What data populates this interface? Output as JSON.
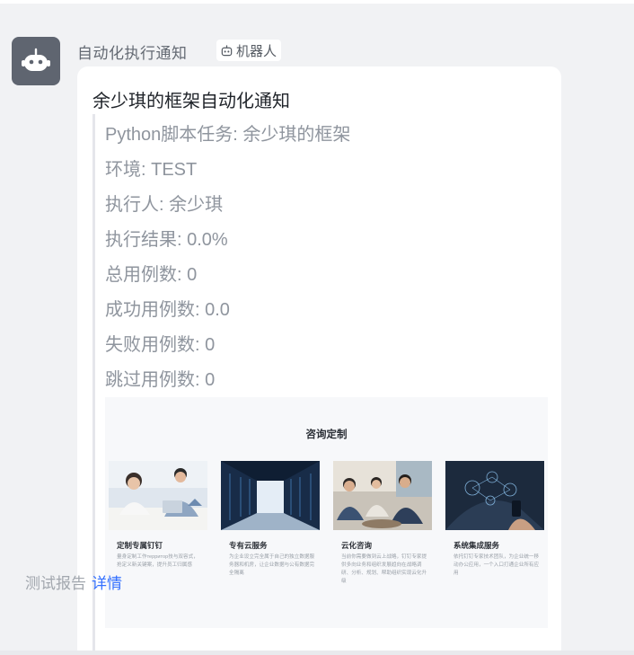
{
  "message": {
    "sender_name": "自动化执行通知",
    "bot_tag": "机器人",
    "avatar_icon": "robot-icon"
  },
  "card": {
    "title": "余少琪的框架自动化通知",
    "fields": [
      "Python脚本任务: 余少琪的框架",
      "环境: TEST",
      "执行人: 余少琪",
      "执行结果: 0.0%",
      "总用例数: 0",
      "成功用例数: 0.0",
      "失败用例数: 0",
      "跳过用例数: 0"
    ],
    "promo": {
      "title": "咨询定制",
      "services": [
        {
          "title": "定制专属钉钉",
          "desc": "量身定制工作территор技与双容式，抢定义新关键案，提升员工归属感"
        },
        {
          "title": "专有云服务",
          "desc": "为企业设立完全属于自己的独立数据服务器和机房，让企业数据与公有数据完全隔离"
        },
        {
          "title": "云化咨询",
          "desc": "当前你需要做到云上战略，钉钉专家提供多向业务和组织发展趋向在战略调研、分析、规划、帮助组织实现云化升级"
        },
        {
          "title": "系统集成服务",
          "desc": "依托钉钉专家技术团队，为企业统一移动办公应用，一个入口打通企业所有应用"
        }
      ]
    },
    "footer": {
      "label": "测试报告",
      "link": "详情"
    }
  },
  "colors": {
    "background": "#f1f2f4",
    "card": "#ffffff",
    "link": "#3370ff",
    "avatar": "#5f6570"
  }
}
